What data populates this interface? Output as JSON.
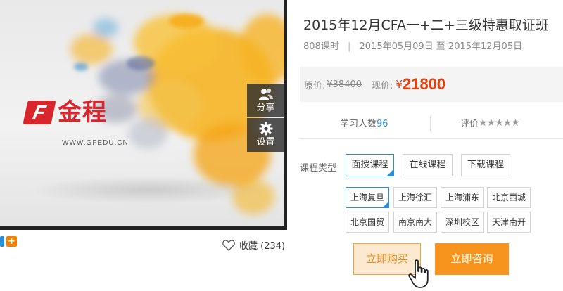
{
  "course": {
    "title": "2015年12月CFA一+二+三级特惠取证班",
    "hours": "808课时",
    "date_range": "2015年05月09日 至 2015年12月05日"
  },
  "price": {
    "original_label": "原价:",
    "original_value": "¥38400",
    "current_label": "现价:",
    "currency": "¥",
    "current_value": "21800"
  },
  "stats": {
    "learners_label": "学习人数",
    "learners_count": "96",
    "rating_label": "评价",
    "rating_stars": "★★★★★"
  },
  "course_type": {
    "label": "课程类型",
    "options": [
      "面授课程",
      "在线课程",
      "下载课程"
    ],
    "selected": "面授课程"
  },
  "locations": {
    "options": [
      "上海复旦",
      "上海徐汇",
      "上海浦东",
      "北京西城",
      "北京国贸",
      "南京南大",
      "深圳校区",
      "天津南开"
    ],
    "selected": "上海复旦"
  },
  "video": {
    "share_label": "分享",
    "settings_label": "设置",
    "logo_mark": "F",
    "logo_text": "金程",
    "logo_url": "WWW.GFEDU.CN"
  },
  "favorite": {
    "label": "收藏 (234)"
  },
  "actions": {
    "buy_label": "立即购买",
    "consult_label": "立即咨询"
  },
  "colors": {
    "accent_orange": "#f7941d",
    "price_red": "#e8400c",
    "select_blue": "#2a8fd6"
  },
  "icons": {
    "share": "people-icon",
    "settings": "gear-icon",
    "favorite": "heart-icon",
    "cursor": "hand-pointer-icon"
  }
}
